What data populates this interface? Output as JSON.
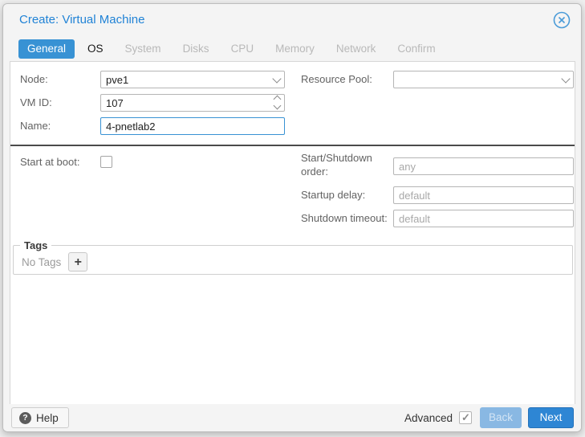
{
  "window": {
    "title": "Create: Virtual Machine",
    "close_icon": "circle-x-icon"
  },
  "tabs": [
    {
      "label": "General",
      "state": "active"
    },
    {
      "label": "OS",
      "state": "enabled"
    },
    {
      "label": "System",
      "state": "disabled"
    },
    {
      "label": "Disks",
      "state": "disabled"
    },
    {
      "label": "CPU",
      "state": "disabled"
    },
    {
      "label": "Memory",
      "state": "disabled"
    },
    {
      "label": "Network",
      "state": "disabled"
    },
    {
      "label": "Confirm",
      "state": "disabled"
    }
  ],
  "form": {
    "node": {
      "label": "Node:",
      "value": "pve1"
    },
    "vmid": {
      "label": "VM ID:",
      "value": "107"
    },
    "name": {
      "label": "Name:",
      "value": "4-pnetlab2"
    },
    "resource_pool": {
      "label": "Resource Pool:",
      "value": ""
    },
    "start_at_boot": {
      "label": "Start at boot:",
      "checked": false
    },
    "start_shutdown_order": {
      "label": "Start/Shutdown order:",
      "placeholder": "any"
    },
    "startup_delay": {
      "label": "Startup delay:",
      "placeholder": "default"
    },
    "shutdown_timeout": {
      "label": "Shutdown timeout:",
      "placeholder": "default"
    }
  },
  "tags": {
    "legend": "Tags",
    "empty_text": "No Tags",
    "add_button": "+"
  },
  "footer": {
    "help_label": "Help",
    "help_icon": "question-circle-icon",
    "advanced_label": "Advanced",
    "advanced_checked": true,
    "back_label": "Back",
    "back_enabled": false,
    "next_label": "Next"
  },
  "colors": {
    "accent_blue": "#3892d4",
    "title_blue": "#2183d6",
    "next_button": "#2e86d4",
    "back_disabled": "#89b8e3",
    "disabled_tab_text": "#b9b9b9",
    "label_gray": "#626262",
    "placeholder_gray": "#a8a8a8"
  }
}
